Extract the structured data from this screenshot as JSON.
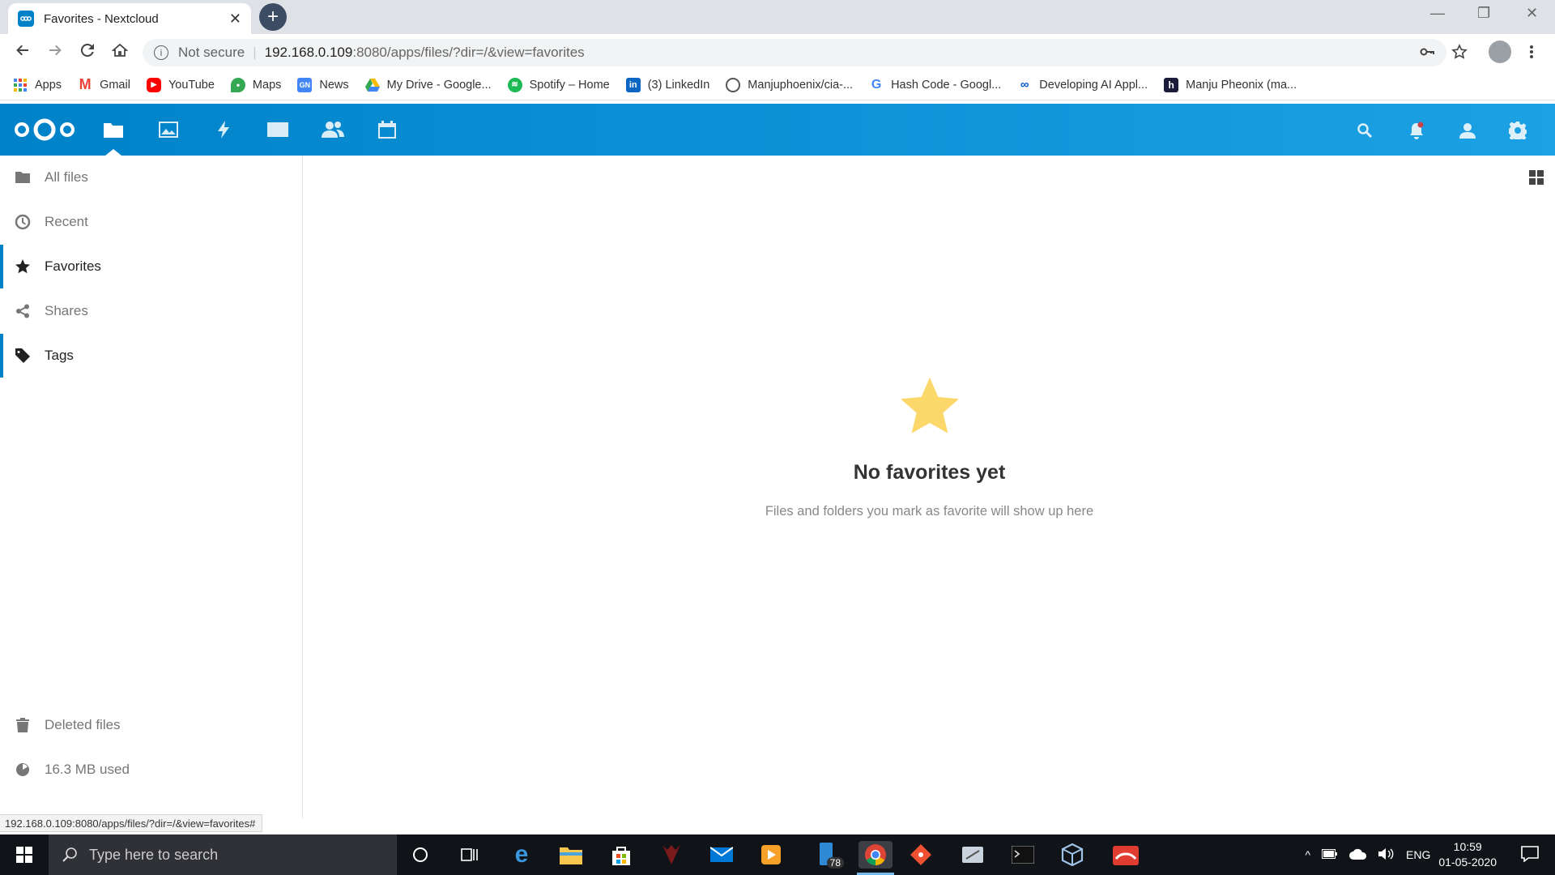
{
  "browser": {
    "tab_title": "Favorites - Nextcloud",
    "tab_close": "✕",
    "new_tab": "+",
    "window_controls": [
      "—",
      "❐",
      "✕"
    ],
    "security_label": "Not secure",
    "url_host": "192.168.0.109",
    "url_path": ":8080/apps/files/?dir=/&view=favorites",
    "bookmarks": [
      {
        "label": "Apps",
        "icon": "apps-grid-icon",
        "color": "#4285f4"
      },
      {
        "label": "Gmail",
        "icon": "gmail-icon",
        "color": "#ea4335"
      },
      {
        "label": "YouTube",
        "icon": "youtube-icon",
        "color": "#ff0000"
      },
      {
        "label": "Maps",
        "icon": "maps-icon",
        "color": "#34a853"
      },
      {
        "label": "News",
        "icon": "news-icon",
        "color": "#4285f4"
      },
      {
        "label": "My Drive - Google...",
        "icon": "drive-icon",
        "color": "#fbbc04"
      },
      {
        "label": "Spotify – Home",
        "icon": "spotify-icon",
        "color": "#1db954"
      },
      {
        "label": "(3) LinkedIn",
        "icon": "linkedin-icon",
        "color": "#0a66c2"
      },
      {
        "label": "Manjuphoenix/cia-...",
        "icon": "github-icon",
        "color": "#24292e"
      },
      {
        "label": "Hash Code - Googl...",
        "icon": "google-icon",
        "color": "#4285f4"
      },
      {
        "label": "Developing AI Appl...",
        "icon": "coursera-icon",
        "color": "#0056d2"
      },
      {
        "label": "Manju Pheonix (ma...",
        "icon": "hashnode-icon",
        "color": "#1b1b3a"
      }
    ]
  },
  "nextcloud": {
    "header_apps": [
      "files-icon",
      "photos-icon",
      "activity-icon",
      "mail-icon",
      "contacts-icon",
      "calendar-icon"
    ],
    "header_right": [
      "search-icon",
      "notifications-icon",
      "user-icon",
      "settings-icon"
    ],
    "sidebar": {
      "items": [
        {
          "label": "All files",
          "icon": "folder-icon"
        },
        {
          "label": "Recent",
          "icon": "clock-icon"
        },
        {
          "label": "Favorites",
          "icon": "star-icon"
        },
        {
          "label": "Shares",
          "icon": "share-icon"
        },
        {
          "label": "Tags",
          "icon": "tag-icon"
        }
      ],
      "bottom": [
        {
          "label": "Deleted files",
          "icon": "trash-icon"
        },
        {
          "label": "16.3 MB used",
          "icon": "quota-pie-icon"
        }
      ]
    },
    "empty": {
      "title": "No favorites yet",
      "message": "Files and folders you mark as favorite will show up here"
    },
    "accent": "#0082c9",
    "star_color": "#fcd769"
  },
  "statusbar": {
    "url": "192.168.0.109:8080/apps/files/?dir=/&view=favorites#"
  },
  "taskbar": {
    "search_placeholder": "Type here to search",
    "badge": "78",
    "language": "ENG",
    "time": "10:59",
    "date": "01-05-2020"
  }
}
